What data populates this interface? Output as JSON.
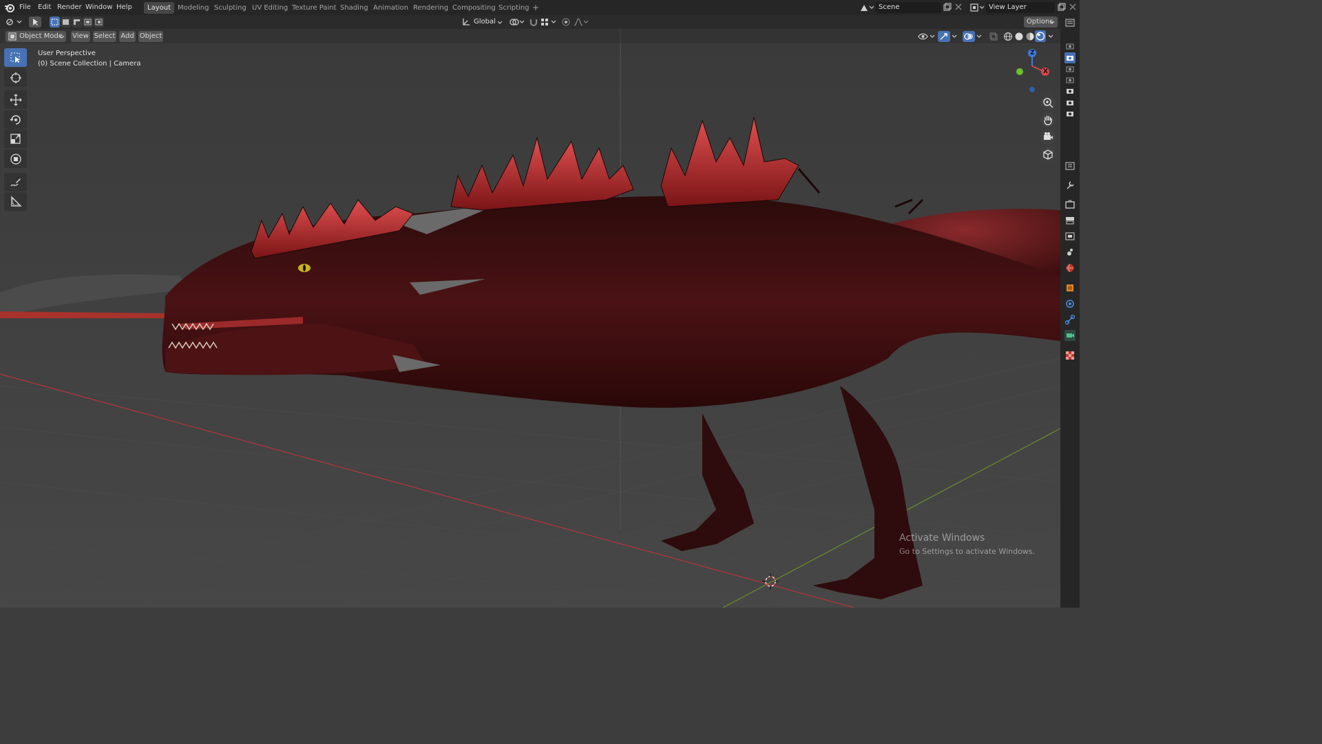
{
  "menu": [
    "File",
    "Edit",
    "Render",
    "Window",
    "Help"
  ],
  "workspaces": [
    "Layout",
    "Modeling",
    "Sculpting",
    "UV Editing",
    "Texture Paint",
    "Shading",
    "Animation",
    "Rendering",
    "Compositing",
    "Scripting"
  ],
  "active_workspace": "Layout",
  "add_workspace": "+",
  "scene": {
    "label": "Scene"
  },
  "view_layer": {
    "label": "View Layer"
  },
  "header": {
    "transform_orientation": "Global",
    "options": "Options"
  },
  "subheader": {
    "mode": "Object Mode",
    "menus": [
      "View",
      "Select",
      "Add",
      "Object"
    ]
  },
  "viewport": {
    "perspective_label": "User Perspective",
    "collection_label": "(0) Scene Collection | Camera",
    "gizmo": {
      "z_label": "Z",
      "x_label": "X"
    }
  },
  "watermark": {
    "title": "Activate Windows",
    "subtitle": "Go to Settings to activate Windows."
  },
  "colors": {
    "accent": "#4772b3",
    "x_axis": "#d9464d",
    "y_axis": "#6fa82a",
    "z_axis": "#3d7be0",
    "creature": "#3a0f0f",
    "spines": "#b0282a"
  },
  "icons": {
    "tools": [
      "select-box-icon",
      "cursor-icon",
      "move-icon",
      "rotate-icon",
      "scale-icon",
      "transform-icon",
      "annotate-icon",
      "measure-icon"
    ],
    "nav": [
      "zoom-icon",
      "pan-hand-icon",
      "camera-view-icon",
      "ortho-grid-icon"
    ],
    "properties": [
      "tool-properties-icon",
      "render-properties-icon",
      "output-properties-icon",
      "view-layer-icon",
      "scene-properties-icon",
      "world-properties-icon",
      "object-properties-icon",
      "modifier-icon",
      "particles-icon",
      "physics-icon",
      "constraints-icon",
      "data-icon",
      "material-icon"
    ]
  }
}
